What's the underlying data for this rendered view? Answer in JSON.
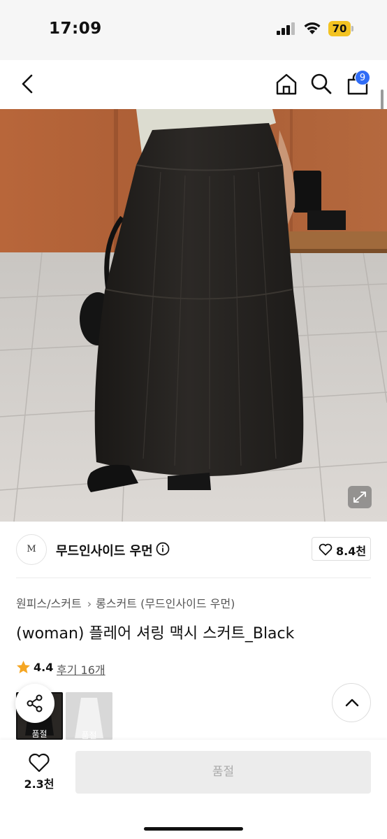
{
  "status_bar": {
    "time": "17:09",
    "battery": "70",
    "battery_color": "#f3c322",
    "icons": [
      "signal-icon",
      "wifi-icon",
      "battery-icon"
    ]
  },
  "nav": {
    "icons": [
      "back-icon",
      "home-icon",
      "search-icon",
      "cart-icon"
    ],
    "cart_badge": "9",
    "badge_color": "#2f6cf6"
  },
  "product_image": {
    "subject": "black gathered maxi skirt photo",
    "icon": "expand-icon"
  },
  "brand": {
    "logo_text": "M",
    "name": "무드인사이드 우먼",
    "like_count": "8.4천"
  },
  "breadcrumb": {
    "category": "원피스/스커트",
    "subcategory": "롱스커트 (무드인사이드 우먼)"
  },
  "product": {
    "title": "(woman) 플레어 셔링 맥시 스커트_Black"
  },
  "rating": {
    "value": "4.4",
    "reviews": "후기 16개",
    "star_color": "#f5a623"
  },
  "thumbnails": [
    {
      "label": "품절"
    },
    {
      "label": "품절"
    }
  ],
  "bottom_bar": {
    "wish_count": "2.3천",
    "buy_label": "품절"
  }
}
